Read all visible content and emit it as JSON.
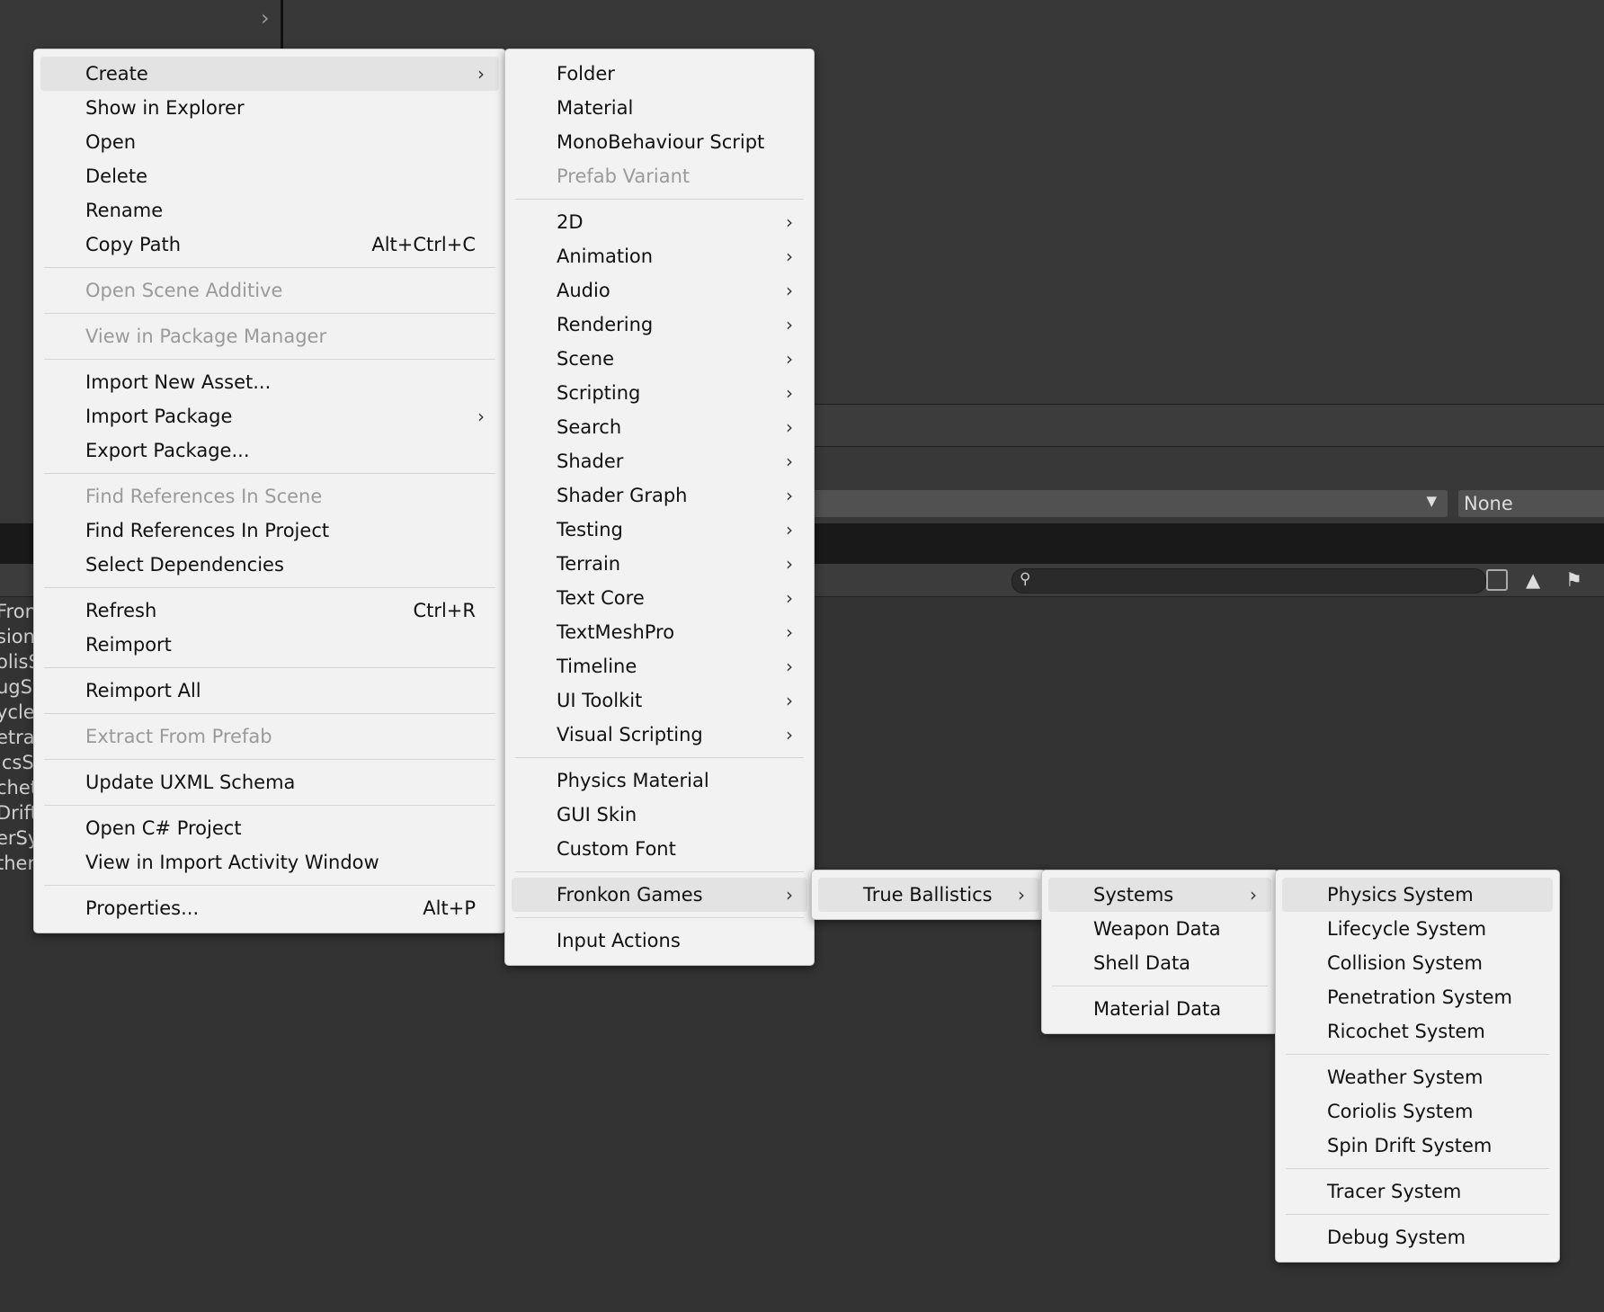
{
  "background": {
    "dropdown_value": "None",
    "left_list": [
      "Fron",
      "sion",
      "olisS",
      "ugSy",
      "ycle",
      "etrat",
      "icsS",
      "chet",
      "Drift",
      "erSy",
      "ther"
    ]
  },
  "main_menu": {
    "groups": [
      [
        {
          "label": "Create",
          "arrow": true,
          "highlight": true
        },
        {
          "label": "Show in Explorer"
        },
        {
          "label": "Open"
        },
        {
          "label": "Delete"
        },
        {
          "label": "Rename"
        },
        {
          "label": "Copy Path",
          "shortcut": "Alt+Ctrl+C"
        }
      ],
      [
        {
          "label": "Open Scene Additive",
          "disabled": true
        }
      ],
      [
        {
          "label": "View in Package Manager",
          "disabled": true
        }
      ],
      [
        {
          "label": "Import New Asset..."
        },
        {
          "label": "Import Package",
          "arrow": true
        },
        {
          "label": "Export Package..."
        }
      ],
      [
        {
          "label": "Find References In Scene",
          "disabled": true
        },
        {
          "label": "Find References In Project"
        },
        {
          "label": "Select Dependencies"
        }
      ],
      [
        {
          "label": "Refresh",
          "shortcut": "Ctrl+R"
        },
        {
          "label": "Reimport"
        }
      ],
      [
        {
          "label": "Reimport All"
        }
      ],
      [
        {
          "label": "Extract From Prefab",
          "disabled": true
        }
      ],
      [
        {
          "label": "Update UXML Schema"
        }
      ],
      [
        {
          "label": "Open C# Project"
        },
        {
          "label": "View in Import Activity Window"
        }
      ],
      [
        {
          "label": "Properties...",
          "shortcut": "Alt+P"
        }
      ]
    ]
  },
  "create_menu": {
    "groups": [
      [
        {
          "label": "Folder"
        },
        {
          "label": "Material"
        },
        {
          "label": "MonoBehaviour Script"
        },
        {
          "label": "Prefab Variant",
          "disabled": true
        }
      ],
      [
        {
          "label": "2D",
          "arrow": true
        },
        {
          "label": "Animation",
          "arrow": true
        },
        {
          "label": "Audio",
          "arrow": true
        },
        {
          "label": "Rendering",
          "arrow": true
        },
        {
          "label": "Scene",
          "arrow": true
        },
        {
          "label": "Scripting",
          "arrow": true
        },
        {
          "label": "Search",
          "arrow": true
        },
        {
          "label": "Shader",
          "arrow": true
        },
        {
          "label": "Shader Graph",
          "arrow": true
        },
        {
          "label": "Testing",
          "arrow": true
        },
        {
          "label": "Terrain",
          "arrow": true
        },
        {
          "label": "Text Core",
          "arrow": true
        },
        {
          "label": "TextMeshPro",
          "arrow": true
        },
        {
          "label": "Timeline",
          "arrow": true
        },
        {
          "label": "UI Toolkit",
          "arrow": true
        },
        {
          "label": "Visual Scripting",
          "arrow": true
        }
      ],
      [
        {
          "label": "Physics Material"
        },
        {
          "label": "GUI Skin"
        },
        {
          "label": "Custom Font"
        }
      ],
      [
        {
          "label": "Fronkon Games",
          "arrow": true,
          "highlight": true
        }
      ],
      [
        {
          "label": "Input Actions"
        }
      ]
    ]
  },
  "fronkon_menu": {
    "groups": [
      [
        {
          "label": "True Ballistics",
          "arrow": true,
          "highlight": true
        }
      ]
    ]
  },
  "ballistics_menu": {
    "groups": [
      [
        {
          "label": "Systems",
          "arrow": true,
          "highlight": true
        },
        {
          "label": "Weapon Data"
        },
        {
          "label": "Shell Data"
        }
      ],
      [
        {
          "label": "Material Data"
        }
      ]
    ]
  },
  "systems_menu": {
    "groups": [
      [
        {
          "label": "Physics System",
          "highlight": true
        },
        {
          "label": "Lifecycle System"
        },
        {
          "label": "Collision System"
        },
        {
          "label": "Penetration System"
        },
        {
          "label": "Ricochet System"
        }
      ],
      [
        {
          "label": "Weather System"
        },
        {
          "label": "Coriolis System"
        },
        {
          "label": "Spin Drift System"
        }
      ],
      [
        {
          "label": "Tracer System"
        }
      ],
      [
        {
          "label": "Debug System"
        }
      ]
    ]
  }
}
